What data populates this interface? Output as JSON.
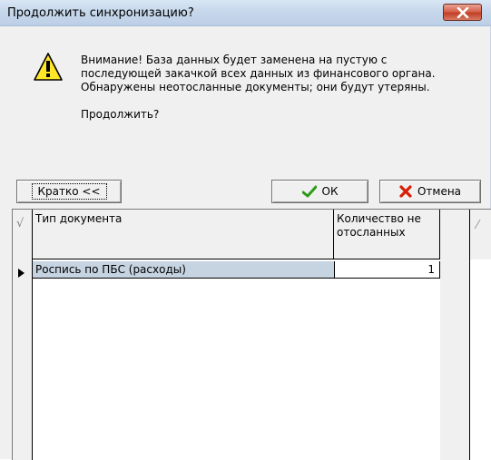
{
  "window": {
    "title": "Продолжить синхронизацию?"
  },
  "message": {
    "line1": "Внимание! База данных будет заменена на пустую  с",
    "line2": "последующей закачкой всех данных из финансового органа.",
    "line3": "Обнаружены неотосланные документы; они будут утеряны.",
    "question": "Продолжить?"
  },
  "buttons": {
    "short_label": "Кратко <<",
    "ok_label": "ОК",
    "cancel_label": "Отмена"
  },
  "grid": {
    "columns": [
      "Тип документа",
      "Количество не отосланных"
    ],
    "rows": [
      {
        "type": "Роспись по ПБС (расходы)",
        "count": "1"
      }
    ]
  },
  "colors": {
    "selected_row": "#c6d3e1",
    "close_button": "#c13f25"
  }
}
